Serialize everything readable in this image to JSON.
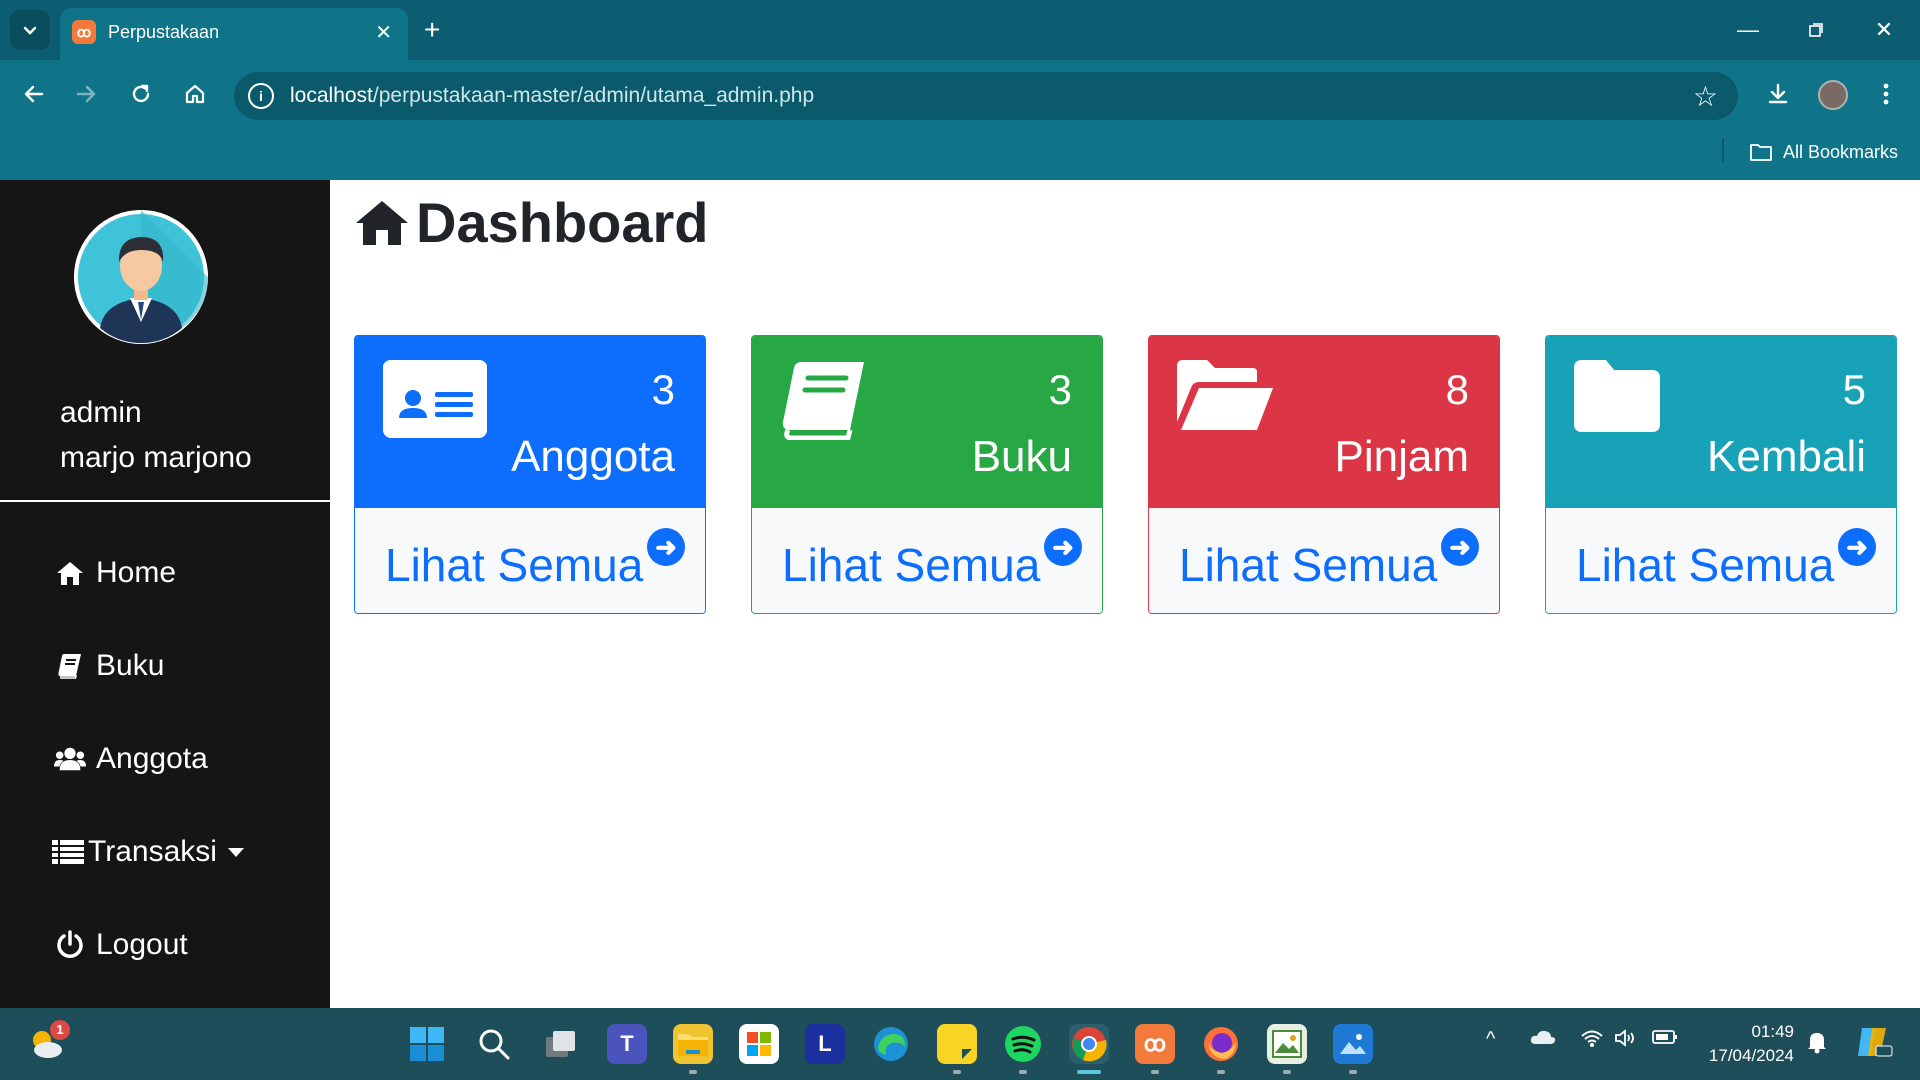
{
  "browser": {
    "tab_title": "Perpustakaan",
    "url_host": "localhost",
    "url_path": "/perpustakaan-master/admin/utama_admin.php",
    "bookmarks_label": "All Bookmarks"
  },
  "sidebar": {
    "user_role": "admin",
    "user_name": "marjo marjono",
    "items": [
      {
        "label": "Home",
        "icon": "home-icon"
      },
      {
        "label": "Buku",
        "icon": "book-icon"
      },
      {
        "label": "Anggota",
        "icon": "users-icon"
      },
      {
        "label": "Transaksi",
        "icon": "list-icon"
      },
      {
        "label": "Logout",
        "icon": "power-icon"
      }
    ]
  },
  "main": {
    "title": "Dashboard",
    "cards": [
      {
        "count": "3",
        "label": "Anggota",
        "link": "Lihat Semua",
        "color": "#0d6efd",
        "icon": "id-card-icon"
      },
      {
        "count": "3",
        "label": "Buku",
        "link": "Lihat Semua",
        "color": "#28a745",
        "icon": "book-icon"
      },
      {
        "count": "8",
        "label": "Pinjam",
        "link": "Lihat Semua",
        "color": "#dc3545",
        "icon": "folder-open-icon"
      },
      {
        "count": "5",
        "label": "Kembali",
        "link": "Lihat Semua",
        "color": "#17a2b8",
        "icon": "folder-icon"
      }
    ]
  },
  "taskbar": {
    "weather_badge": "1",
    "time": "01:49",
    "date": "17/04/2024"
  }
}
